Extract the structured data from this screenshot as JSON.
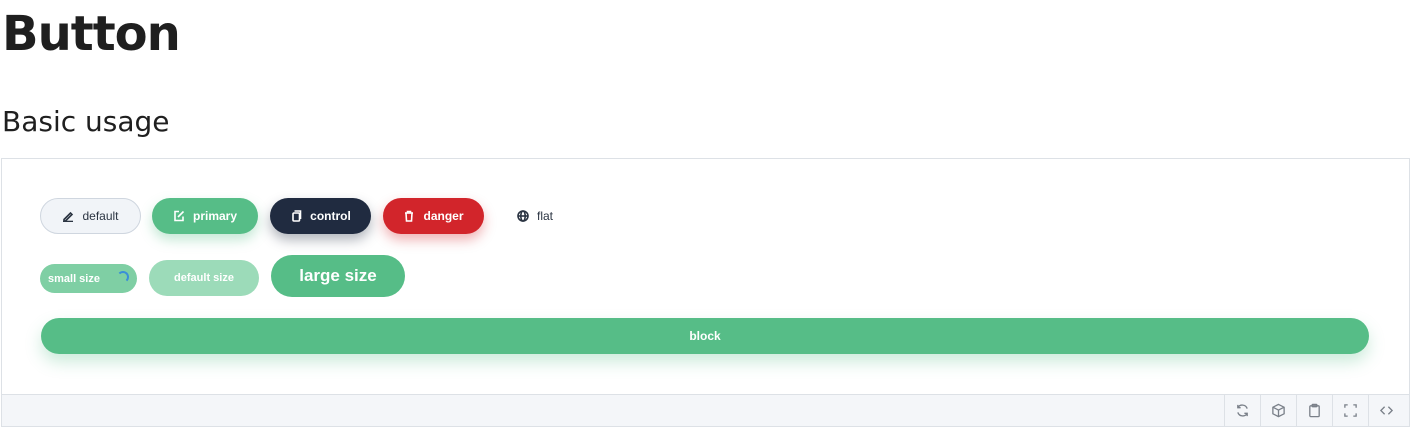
{
  "page": {
    "title": "Button",
    "section_title": "Basic usage"
  },
  "buttons": {
    "default": {
      "label": "default",
      "icon": "pencil-icon"
    },
    "primary": {
      "label": "primary",
      "icon": "edit-icon"
    },
    "control": {
      "label": "control",
      "icon": "copy-icon"
    },
    "danger": {
      "label": "danger",
      "icon": "trash-icon"
    },
    "flat": {
      "label": "flat",
      "icon": "globe-icon"
    }
  },
  "sizes": {
    "small": {
      "label": "small size",
      "loading": true
    },
    "default": {
      "label": "default size"
    },
    "large": {
      "label": "large size"
    }
  },
  "block": {
    "label": "block"
  },
  "toolbar": {
    "icons": [
      "refresh-icon",
      "cube-icon",
      "clipboard-icon",
      "fullscreen-icon",
      "code-icon"
    ]
  },
  "colors": {
    "primary": "#56bd87",
    "control": "#202b40",
    "danger": "#d2252b",
    "default_bg": "#f1f4f8"
  }
}
